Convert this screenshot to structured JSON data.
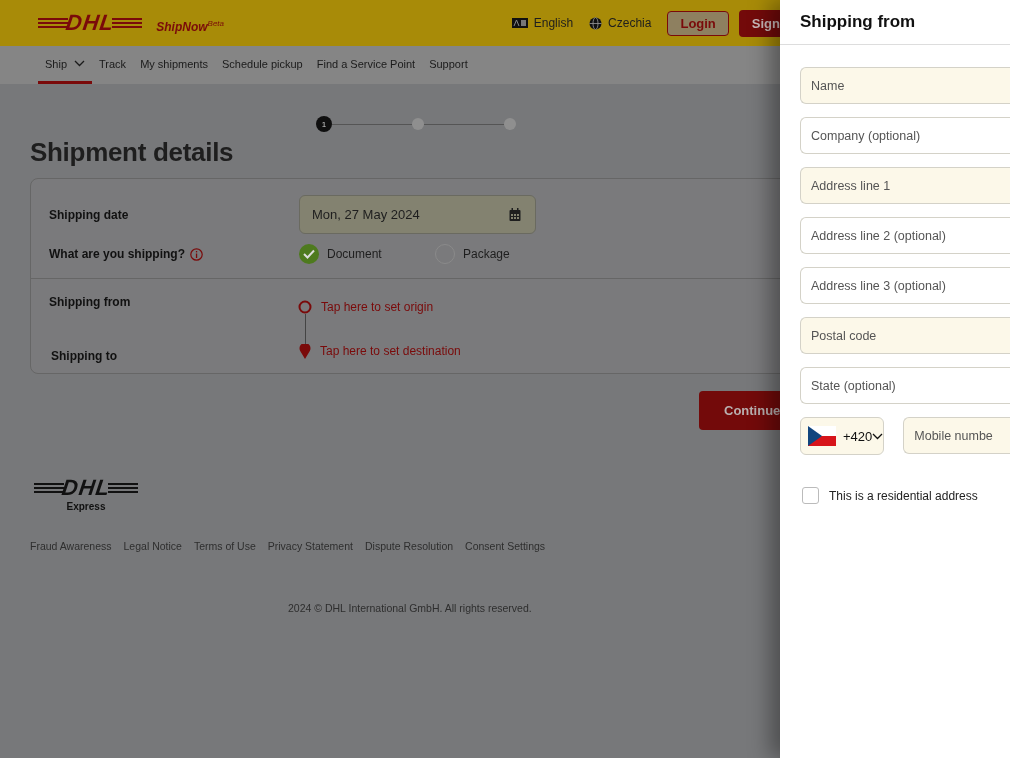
{
  "header": {
    "logo": "DHL",
    "product": "ShipNow$^{Beta}$",
    "language": "English",
    "country": "Czechia",
    "login_button": "Login",
    "signup_button": "Sign"
  },
  "nav": [
    {
      "label": "Ship",
      "selected": true,
      "has_menu": true
    },
    {
      "label": "Track",
      "selected": false,
      "has_menu": false
    },
    {
      "label": "My shipments",
      "selected": false,
      "has_menu": false
    },
    {
      "label": "Schedule pickup",
      "selected": false,
      "has_menu": false
    },
    {
      "label": "Find a Service Point",
      "selected": false,
      "has_menu": false
    },
    {
      "label": "Support",
      "selected": false,
      "has_menu": false
    }
  ],
  "stepper": [
    {
      "label": "1",
      "selected": true
    },
    {
      "selected": false
    },
    {
      "selected": false
    }
  ],
  "page_title": "Shipment details",
  "form": {
    "date_label": "Shipping date",
    "date_value": "Mon, 27 May 2024",
    "type_label": "What are you shipping?",
    "types": [
      {
        "label": "Document",
        "selected": true
      },
      {
        "label": "Package",
        "selected": false
      }
    ],
    "from_label": "Shipping from",
    "to_label": "Shipping to",
    "origin_link": "Tap here to set origin",
    "destination_link": "Tap here to set destination"
  },
  "continue_button": "Continue",
  "footer": {
    "logo": "DHL",
    "logo_caption": "Express",
    "links": [
      "Fraud Awareness",
      "Legal Notice",
      "Terms of Use",
      "Privacy Statement",
      "Dispute Resolution",
      "Consent Settings"
    ],
    "copyright": "2024 © DHL International GmbH. All rights reserved."
  },
  "drawer": {
    "title": "Shipping from",
    "fields": [
      {
        "placeholder": "Name",
        "required": true
      },
      {
        "placeholder": "Company (optional)",
        "required": false
      },
      {
        "placeholder": "Address line 1",
        "required": true
      },
      {
        "placeholder": "Address line 2 (optional)",
        "required": false
      },
      {
        "placeholder": "Address line 3 (optional)",
        "required": false
      },
      {
        "placeholder": "Postal code",
        "required": true
      },
      {
        "placeholder": "State (optional)",
        "required": false
      }
    ],
    "phone": {
      "dial_code": "+420",
      "placeholder": "Mobile numbe"
    },
    "residential": {
      "label": "This is a residential address",
      "checked": false
    }
  }
}
